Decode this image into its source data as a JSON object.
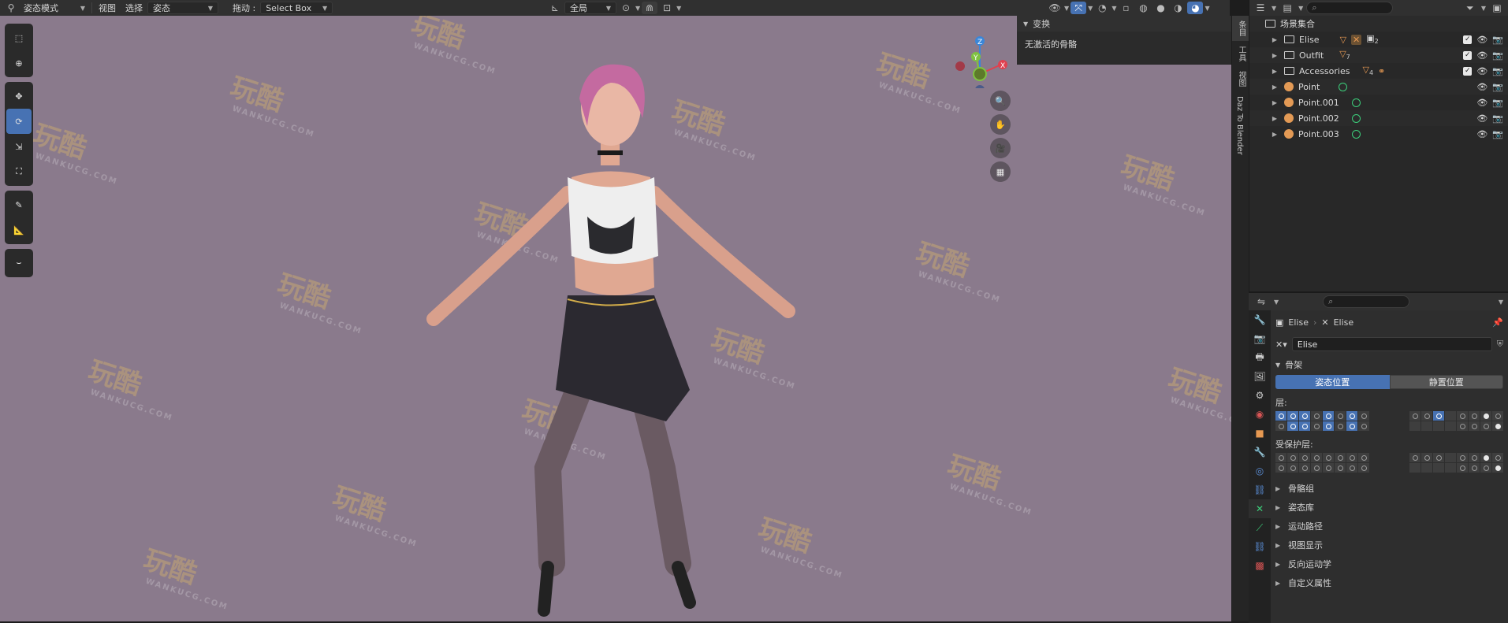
{
  "header": {
    "mode": "姿态模式",
    "menu_view": "视图",
    "menu_select": "选择",
    "menu_pose": "姿态",
    "drag_label": "拖动 :",
    "select_box": "Select Box",
    "orientation": "全局"
  },
  "viewport": {
    "n_panel_title": "变换",
    "n_panel_msg": "无激活的骨骼",
    "tabs": [
      "条目",
      "工具",
      "视图",
      "Daz To Blender"
    ],
    "gizmo": {
      "z": "Z",
      "y": "Y",
      "x": "X"
    },
    "watermark": "玩酷",
    "watermark_url": "WANKUCG.COM"
  },
  "outliner": {
    "root": "场景集合",
    "items": [
      {
        "name": "Elise",
        "type": "collection",
        "extra": "2"
      },
      {
        "name": "Outfit",
        "type": "collection",
        "extra": "7"
      },
      {
        "name": "Accessories",
        "type": "collection",
        "extra": "4"
      },
      {
        "name": "Point",
        "type": "light"
      },
      {
        "name": "Point.001",
        "type": "light"
      },
      {
        "name": "Point.002",
        "type": "light"
      },
      {
        "name": "Point.003",
        "type": "light"
      }
    ]
  },
  "properties": {
    "breadcrumb_obj": "Elise",
    "breadcrumb_data": "Elise",
    "data_name": "Elise",
    "section_skeleton": "骨架",
    "btn_pose_position": "姿态位置",
    "btn_rest_position": "静置位置",
    "layers_label": "层:",
    "protected_label": "受保护层:",
    "subpanels": [
      "骨骼组",
      "姿态库",
      "运动路径",
      "视图显示",
      "反向运动学",
      "自定义属性"
    ]
  },
  "colors": {
    "viewport_bg": "#8a7a8c",
    "accent": "#4772b3",
    "axis_x": "#e0414f",
    "axis_y": "#7fc241",
    "axis_z": "#3a86d8"
  }
}
